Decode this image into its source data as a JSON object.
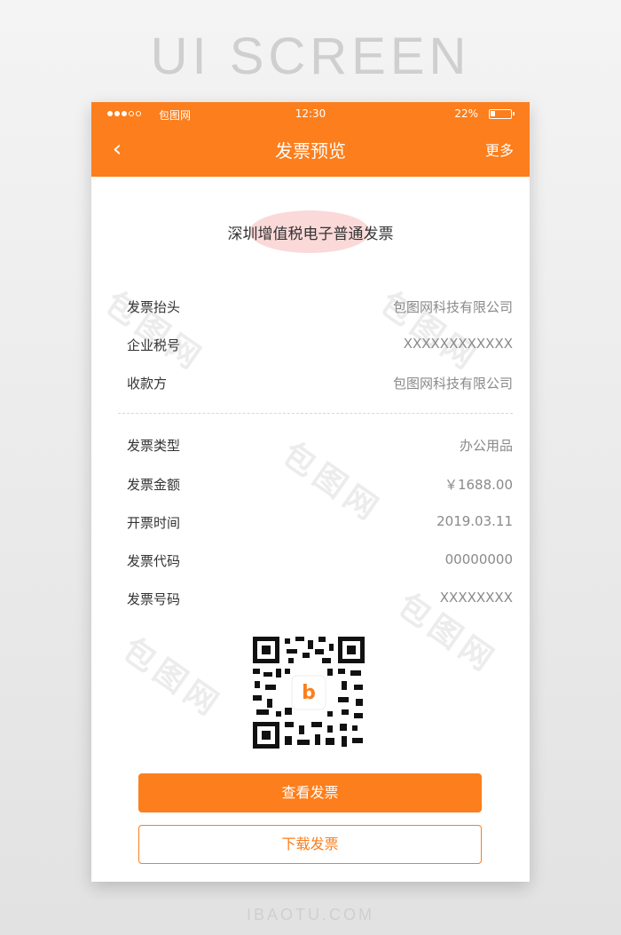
{
  "page": {
    "heading": "UI SCREEN",
    "footer": "IBAOTU.COM"
  },
  "status_bar": {
    "carrier": "包图网",
    "time": "12:30",
    "battery_text": "22%",
    "battery_level": 0.22
  },
  "nav": {
    "back_icon": "chevron-left-icon",
    "title": "发票预览",
    "more_label": "更多"
  },
  "invoice": {
    "title": "深圳增值税电子普通发票",
    "header_rows": [
      {
        "label": "发票抬头",
        "value": "包图网科技有限公司"
      },
      {
        "label": "企业税号",
        "value": "XXXXXXXXXXXX"
      },
      {
        "label": "收款方",
        "value": "包图网科技有限公司"
      }
    ],
    "detail_rows": [
      {
        "label": "发票类型",
        "value": "办公用品"
      },
      {
        "label": "发票金额",
        "value": "￥1688.00"
      },
      {
        "label": "开票时间",
        "value": "2019.03.11"
      },
      {
        "label": "发票代码",
        "value": "00000000"
      },
      {
        "label": "发票号码",
        "value": "XXXXXXXX"
      }
    ]
  },
  "qr": {
    "icon": "qr-code-icon",
    "logo_letter": "b"
  },
  "actions": {
    "view_label": "查看发票",
    "download_label": "下载发票"
  },
  "colors": {
    "accent": "#fc7e1c",
    "text": "#333333",
    "muted": "#8a8a8a"
  }
}
